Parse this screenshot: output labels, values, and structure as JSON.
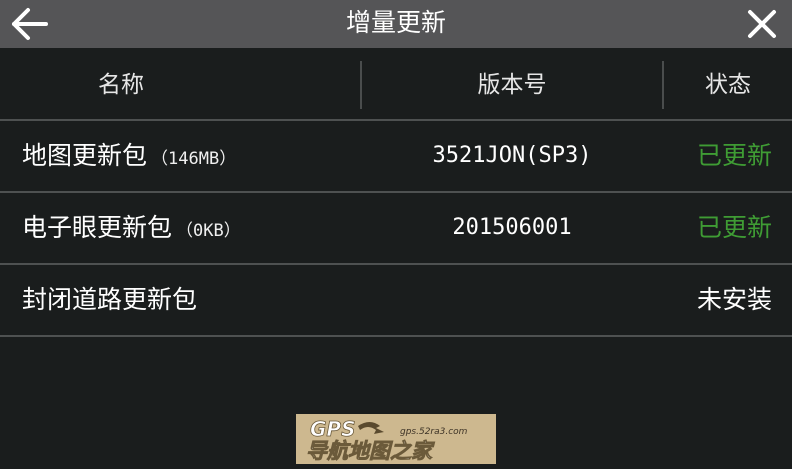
{
  "titlebar": {
    "title": "增量更新",
    "back_icon": "arrow-left-icon",
    "close_icon": "close-icon"
  },
  "table": {
    "headers": {
      "name": "名称",
      "version": "版本号",
      "status": "状态"
    },
    "rows": [
      {
        "name": "地图更新包",
        "size": "（146MB）",
        "version": "3521JON(SP3)",
        "status": "已更新",
        "status_color": "#3f9c34"
      },
      {
        "name": "电子眼更新包",
        "size": "（0KB）",
        "version": "201506001",
        "status": "已更新",
        "status_color": "#3f9c34"
      },
      {
        "name": "封闭道路更新包",
        "size": "",
        "version": "",
        "status": "未安装",
        "status_color": "#ffffff"
      }
    ]
  },
  "watermark": {
    "brand": "GPS",
    "url": "gps.52ra3.com",
    "text": "导航地图之家"
  },
  "colors": {
    "titlebar_bg": "#555557",
    "page_bg": "#1a1d1d",
    "status_updated": "#3f9c34"
  }
}
